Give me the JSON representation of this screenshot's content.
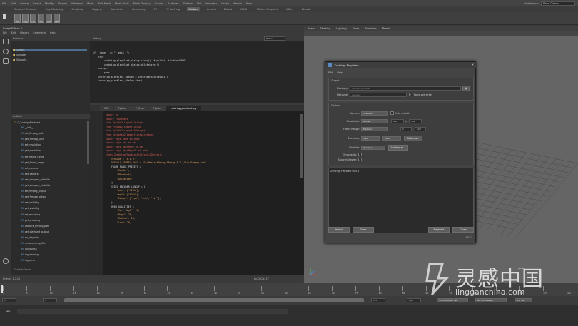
{
  "menubar": {
    "items": [
      "File",
      "Edit",
      "Create",
      "Select",
      "Modify",
      "Display",
      "Windows",
      "Mesh",
      "Edit Mesh",
      "Mesh Tools",
      "Mesh Display",
      "Curves",
      "Surfaces",
      "Deform",
      "UV",
      "Generate",
      "Cache",
      "Arnold",
      "Help"
    ],
    "workspace_label": "Workspace:",
    "workspace_value": "Maya Classic"
  },
  "shelf": {
    "tabs": [
      "Curves / Surfaces",
      "Poly Modeling",
      "Sculpting",
      "Rigging",
      "Animation",
      "Rendering",
      "FX",
      "FX Caching",
      "Custom",
      "Arnold",
      "Bifrost",
      "MASH",
      "Motion Graphics",
      "XGen",
      "Zbrush"
    ],
    "active_tab": "Custom",
    "icons": [
      "Blst",
      "Copy",
      "Fbx",
      "Wiz",
      "Rnd",
      "Path"
    ]
  },
  "script_editor": {
    "title": "Script Editor 2",
    "menus": [
      "File",
      "Edit",
      "History",
      "Command",
      "Help"
    ],
    "explorer_header": "Explorer",
    "explorer_rows": [
      "Scripts",
      "Samples",
      "Snippets"
    ],
    "language": "Python"
  },
  "outliner": {
    "header": "Outliner",
    "root": "C_ZurbriggPlayblast",
    "items": [
      "__init__",
      "set_ffmpeg_path",
      "get_ffmpeg_path",
      "set_resolution",
      "get_resolution",
      "set_frame_range",
      "get_frame_range",
      "set_camera",
      "get_camera",
      "set_viewport_visibility",
      "get_viewport_visibility",
      "set_ffmpeg_output",
      "get_ffmpeg_output",
      "set_visibility",
      "get_visibility",
      "set_encoding",
      "get_encoding",
      "validate_ffmpeg_path",
      "get_playblast_output",
      "do_playblast",
      "remove_temp_files",
      "log_output",
      "log_warning",
      "log_error"
    ],
    "footer": "Outline Groups"
  },
  "history_code": [
    "if __name__ == \"__main__\":",
    "",
    "    try:",
    "        zurbrigg_playblast_dialog.close()  # pylint: disable=E0601",
    "        zurbrigg_playblast_dialog.deleteLater()",
    "    except:",
    "        pass",
    "",
    "    zurbrigg_playblast_dialog = ZurbriggPlayblastUi()",
    "    zurbrigg_playblast_dialog.show()"
  ],
  "editor_tabs": [
    "MEL",
    "Python",
    "Python",
    "Python",
    "zurbrigg_playblast.py"
  ],
  "editor_active_tab": 4,
  "editor_code": [
    "import os",
    "import traceback",
    "",
    "from PySide2 import QtCore",
    "from PySide2 import QtGui",
    "from PySide2 import QtWidgets",
    "from shiboken2 import wrapInstance",
    "",
    "import maya.cmds as cmds",
    "import maya.mel as mel",
    "import maya.OpenMaya as om",
    "import maya.OpenMayaUI as omui",
    "",
    "",
    "class ZurbriggPlayblast(QtCore.QObject):",
    "",
    "    VERSION = \"0.0.3\"",
    "",
    "    DEFAULT_FFMPEG_PATH = \"D:/Media/ffmpeg/ffmpeg-4.2.1/bin/ffmpeg.exe\"",
    "",
    "    FRAME_RANGE_PRESETS = [",
    "        \"Render\",",
    "        \"Playback\",",
    "        \"Animation\",",
    "    ]",
    "",
    "    VIDEO_ENCODER_LOOKUP = {",
    "        \"mov\": [\"h264\"],",
    "        \"mp4\": [\"h264\"],",
    "        \"Image\": [\"jpg\", \"png\", \"tif\"],",
    "    }",
    "",
    "    H264_QUALITIES = {",
    "        \"Very High\": 18,",
    "        \"High\": 20,",
    "        \"Medium\": 23,",
    "        \"Low\": 26,"
  ],
  "status": {
    "left": "Python: 2.7.11",
    "position": "Ln: 2 Col: 17"
  },
  "viewport": {
    "menus": [
      "View",
      "Shading",
      "Lighting",
      "Show",
      "Renderer",
      "Panels"
    ],
    "camera": "persp"
  },
  "dialog": {
    "title": "Zurbrigg Playblast",
    "menus": [
      "Edit",
      "Help"
    ],
    "output_section": "Output",
    "directory_label": "Directory:",
    "directory_placeholder": "{project}/movies",
    "filename_label": "Filename:",
    "filename_placeholder": "{scene}",
    "force_overwrite": "Force overwrite",
    "options_section": "Options",
    "camera_label": "Camera:",
    "camera_value": "<Active>",
    "hide_defaults": "Hide defaults",
    "resolution_label": "Resolution:",
    "resolution_value": "Render",
    "res_w": "960",
    "res_h": "540",
    "frame_range_label": "Frame Range:",
    "frame_range_value": "Playback",
    "frame_start": "1",
    "frame_end": "120",
    "encoding_label": "Encoding:",
    "encoding_container": "mp4",
    "encoding_codec": "h264",
    "settings_btn": "Settings...",
    "visibility_label": "Visibility:",
    "visibility_value": "Viewport",
    "customize_btn": "Customize...",
    "ornaments_label": "Ornaments:",
    "viewer_label": "Show in Viewer:",
    "log_text": "Zurbrigg Playblast v0.0.3",
    "refresh_btn": "Refresh",
    "clear_btn": "Clear",
    "playblast_btn": "Playblast",
    "close_btn": "Close",
    "version": "v0.0.3"
  },
  "timeline": {
    "ticks": [
      "1",
      "5",
      "10",
      "15",
      "20",
      "25",
      "30",
      "35",
      "40",
      "45",
      "50",
      "55",
      "60",
      "65",
      "70",
      "75",
      "80",
      "85",
      "90",
      "95",
      "100",
      "105",
      "110",
      "115",
      "120"
    ],
    "start": "1",
    "range_start": "1",
    "range_end": "120",
    "end": "200",
    "no_character": "No Character Set",
    "no_anim_layer": "No Anim Layer",
    "fps": "24 fps"
  },
  "cmdline": {
    "label": "MEL"
  },
  "watermark": {
    "cn": "灵感中国",
    "url": "lingganchina.com"
  }
}
